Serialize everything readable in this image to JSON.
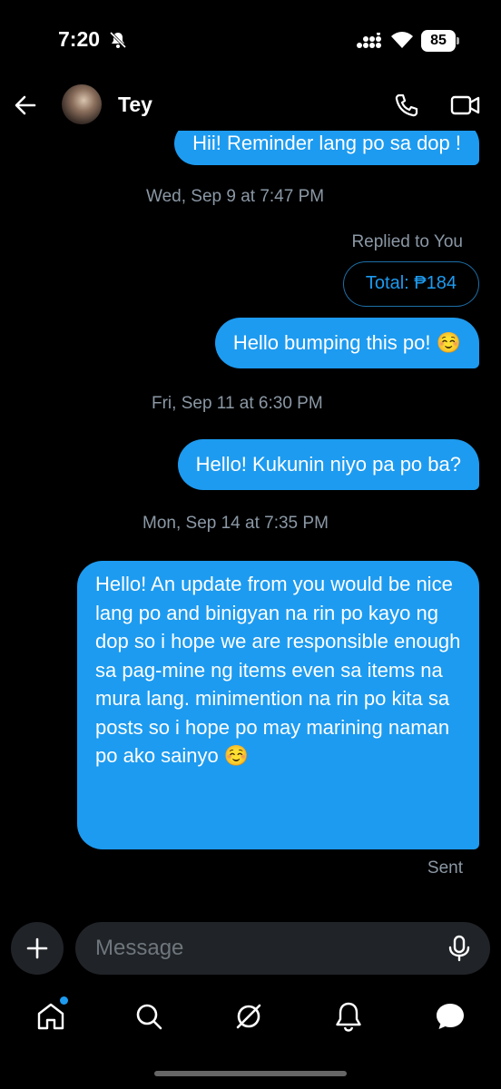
{
  "status_bar": {
    "time": "7:20",
    "battery": "85"
  },
  "header": {
    "contact_name": "Tey"
  },
  "thread": {
    "messages": [
      {
        "text": "Hii! Reminder lang po sa dop !"
      },
      {
        "timestamp": "Wed, Sep 9 at 7:47 PM"
      },
      {
        "replied_label": "Replied to You",
        "quoted_text": "Total: ₱184"
      },
      {
        "text": "Hello bumping this po! ☺️"
      },
      {
        "timestamp": "Fri, Sep 11 at 6:30 PM"
      },
      {
        "text": "Hello! Kukunin niyo pa po ba?"
      },
      {
        "timestamp": "Mon, Sep 14 at 7:35 PM"
      },
      {
        "text": "Hello! An update from you would be nice lang po and binigyan na rin po kayo ng dop so i hope we are responsible enough sa pag-mine ng items even sa items na mura lang. minimention na rin po kita sa posts so i hope po may marining naman po ako sainyo ☺️"
      }
    ],
    "last_status": "Sent"
  },
  "composer": {
    "placeholder": "Message",
    "value": ""
  },
  "colors": {
    "background": "#000000",
    "bubble": "#1d9bf0",
    "muted_text": "#8b98a5",
    "input_bg": "#202327"
  },
  "icons": [
    "back-arrow-icon",
    "phone-icon",
    "video-icon",
    "plus-icon",
    "mic-icon",
    "home-icon",
    "search-icon",
    "grok-icon",
    "bell-icon",
    "messages-icon",
    "bell-off-icon",
    "signal-icon",
    "wifi-icon"
  ]
}
